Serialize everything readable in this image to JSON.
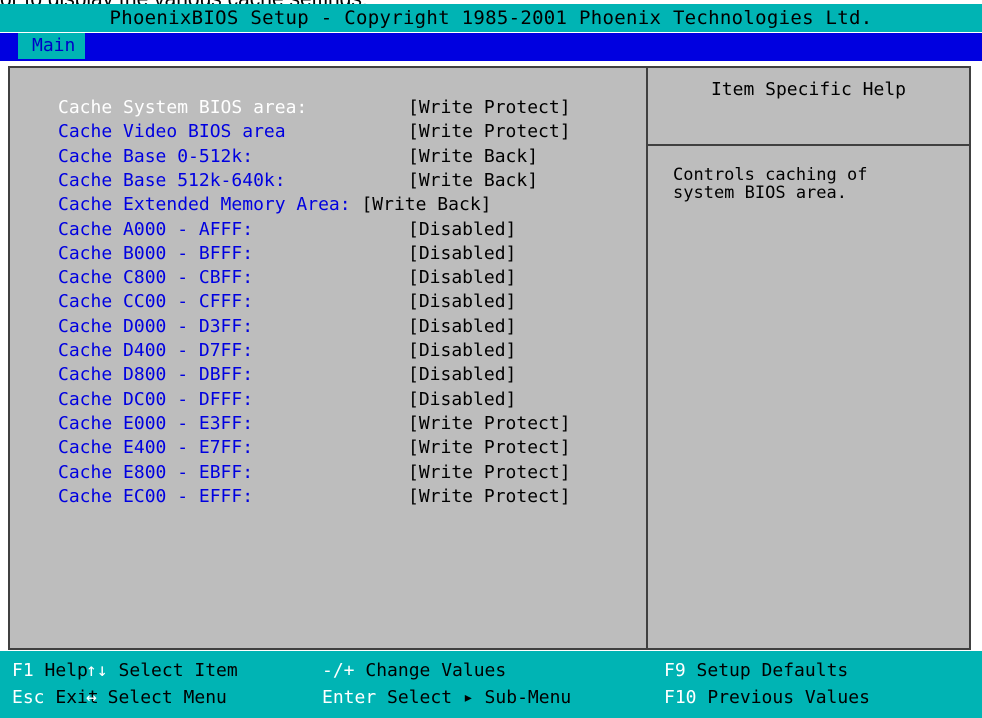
{
  "caption": "or to display the various cache settings:",
  "title": "PhoenixBIOS Setup - Copyright 1985-2001 Phoenix Technologies Ltd.",
  "menu": {
    "active_tab": "Main"
  },
  "settings": [
    {
      "label": "Cache System BIOS area:",
      "value": "[Write Protect]",
      "selected": true
    },
    {
      "label": "Cache Video BIOS area",
      "value": "[Write Protect]"
    },
    {
      "label": "Cache Base 0-512k:",
      "value": "[Write Back]"
    },
    {
      "label": "Cache Base 512k-640k:",
      "value": "[Write Back]"
    },
    {
      "label": "Cache Extended Memory Area:",
      "value": "[Write Back]",
      "inline": true
    },
    {
      "label": "Cache A000 - AFFF:",
      "value": "[Disabled]"
    },
    {
      "label": "Cache B000 - BFFF:",
      "value": "[Disabled]"
    },
    {
      "label": "Cache C800 - CBFF:",
      "value": "[Disabled]"
    },
    {
      "label": "Cache CC00 - CFFF:",
      "value": "[Disabled]"
    },
    {
      "label": "Cache D000 - D3FF:",
      "value": "[Disabled]"
    },
    {
      "label": "Cache D400 - D7FF:",
      "value": "[Disabled]"
    },
    {
      "label": "Cache D800 - DBFF:",
      "value": "[Disabled]"
    },
    {
      "label": "Cache DC00 - DFFF:",
      "value": "[Disabled]"
    },
    {
      "label": "Cache E000 - E3FF:",
      "value": "[Write Protect]"
    },
    {
      "label": "Cache E400 - E7FF:",
      "value": "[Write Protect]"
    },
    {
      "label": "Cache E800 - EBFF:",
      "value": "[Write Protect]"
    },
    {
      "label": "Cache EC00 - EFFF:",
      "value": "[Write Protect]"
    }
  ],
  "help": {
    "title": "Item Specific Help",
    "text": "Controls caching of\nsystem BIOS area."
  },
  "keys": {
    "row1": [
      {
        "key": "F1",
        "desc": "Help"
      },
      {
        "key": "↑↓",
        "desc": "Select Item"
      },
      {
        "key": "-/+",
        "desc": "Change Values"
      },
      {
        "key": "F9",
        "desc": "Setup Defaults"
      }
    ],
    "row2": [
      {
        "key": "Esc",
        "desc": "Exit"
      },
      {
        "key": "↔",
        "desc": "Select Menu"
      },
      {
        "key": "Enter",
        "desc": "Select ▸ Sub-Menu"
      },
      {
        "key": "F10",
        "desc": "Previous Values"
      }
    ]
  },
  "colors": {
    "cyan": "#00b4b4",
    "blue": "#0000e0",
    "panel_gray": "#bdbdbd",
    "highlight": "#ffffff"
  }
}
